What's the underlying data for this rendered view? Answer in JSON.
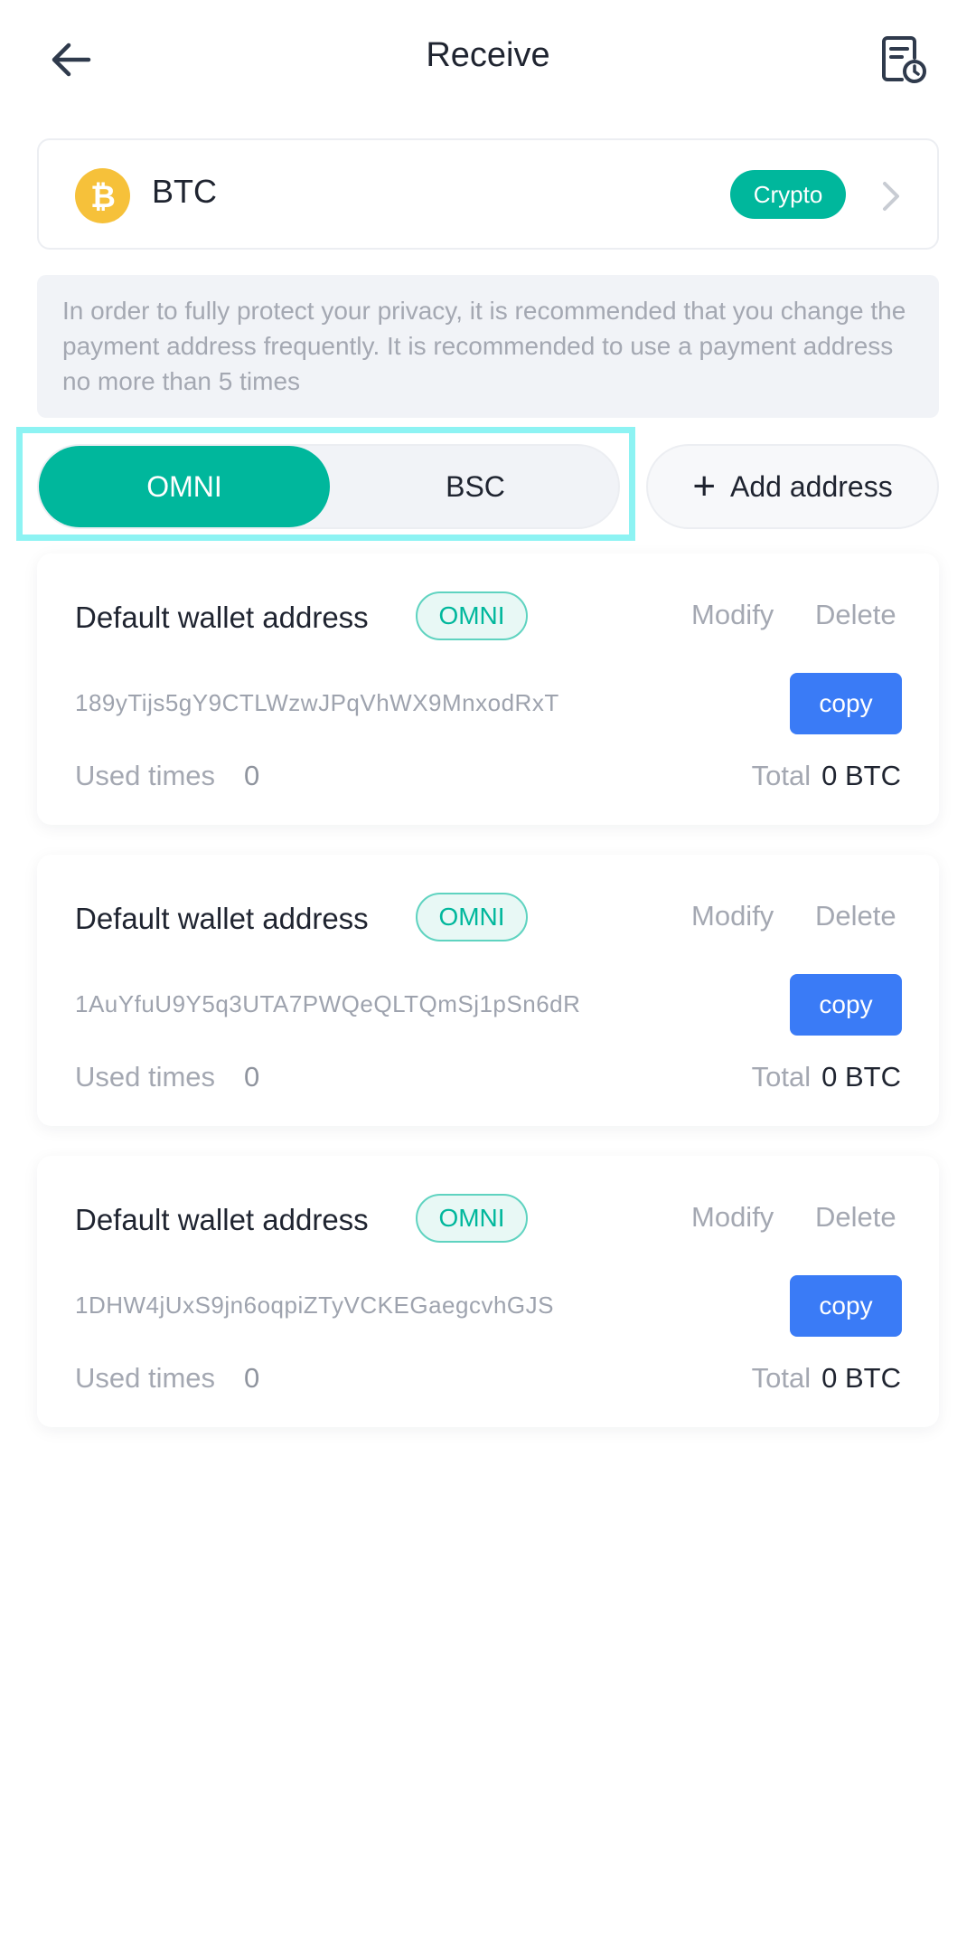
{
  "header": {
    "title": "Receive",
    "back_icon": "arrow-left-icon",
    "history_icon": "receipt-clock-icon"
  },
  "coin": {
    "symbol": "BTC",
    "icon": "bitcoin-icon",
    "badge": "Crypto",
    "chevron_icon": "chevron-right-icon"
  },
  "notice": {
    "text": "In order to fully protect your privacy, it is recommended that you change the payment address frequently. It is recommended to use a payment address no more than 5 times"
  },
  "network": {
    "tabs": [
      {
        "label": "OMNI",
        "selected": true
      },
      {
        "label": "BSC",
        "selected": false
      }
    ]
  },
  "add_address": {
    "label": "Add address",
    "icon": "plus-icon"
  },
  "addresses": [
    {
      "title": "Default wallet address",
      "tag": "OMNI",
      "modify": "Modify",
      "delete": "Delete",
      "address": "189yTijs5gY9CTLWzwJPqVhWX9MnxodRxT",
      "copy": "copy",
      "used_label": "Used times",
      "used_value": "0",
      "total_label": "Total",
      "total_value": "0 BTC"
    },
    {
      "title": "Default wallet address",
      "tag": "OMNI",
      "modify": "Modify",
      "delete": "Delete",
      "address": "1AuYfuU9Y5q3UTA7PWQeQLTQmSj1pSn6dR",
      "copy": "copy",
      "used_label": "Used times",
      "used_value": "0",
      "total_label": "Total",
      "total_value": "0 BTC"
    },
    {
      "title": "Default wallet address",
      "tag": "OMNI",
      "modify": "Modify",
      "delete": "Delete",
      "address": "1DHW4jUxS9jn6oqpiZTyVCKEGaegcvhGJS",
      "copy": "copy",
      "used_label": "Used times",
      "used_value": "0",
      "total_label": "Total",
      "total_value": "0 BTC"
    }
  ],
  "colors": {
    "accent": "#00b79c",
    "copy_button": "#3a7bf6",
    "bitcoin": "#f6c13a",
    "highlight_frame": "#8df3f3"
  }
}
